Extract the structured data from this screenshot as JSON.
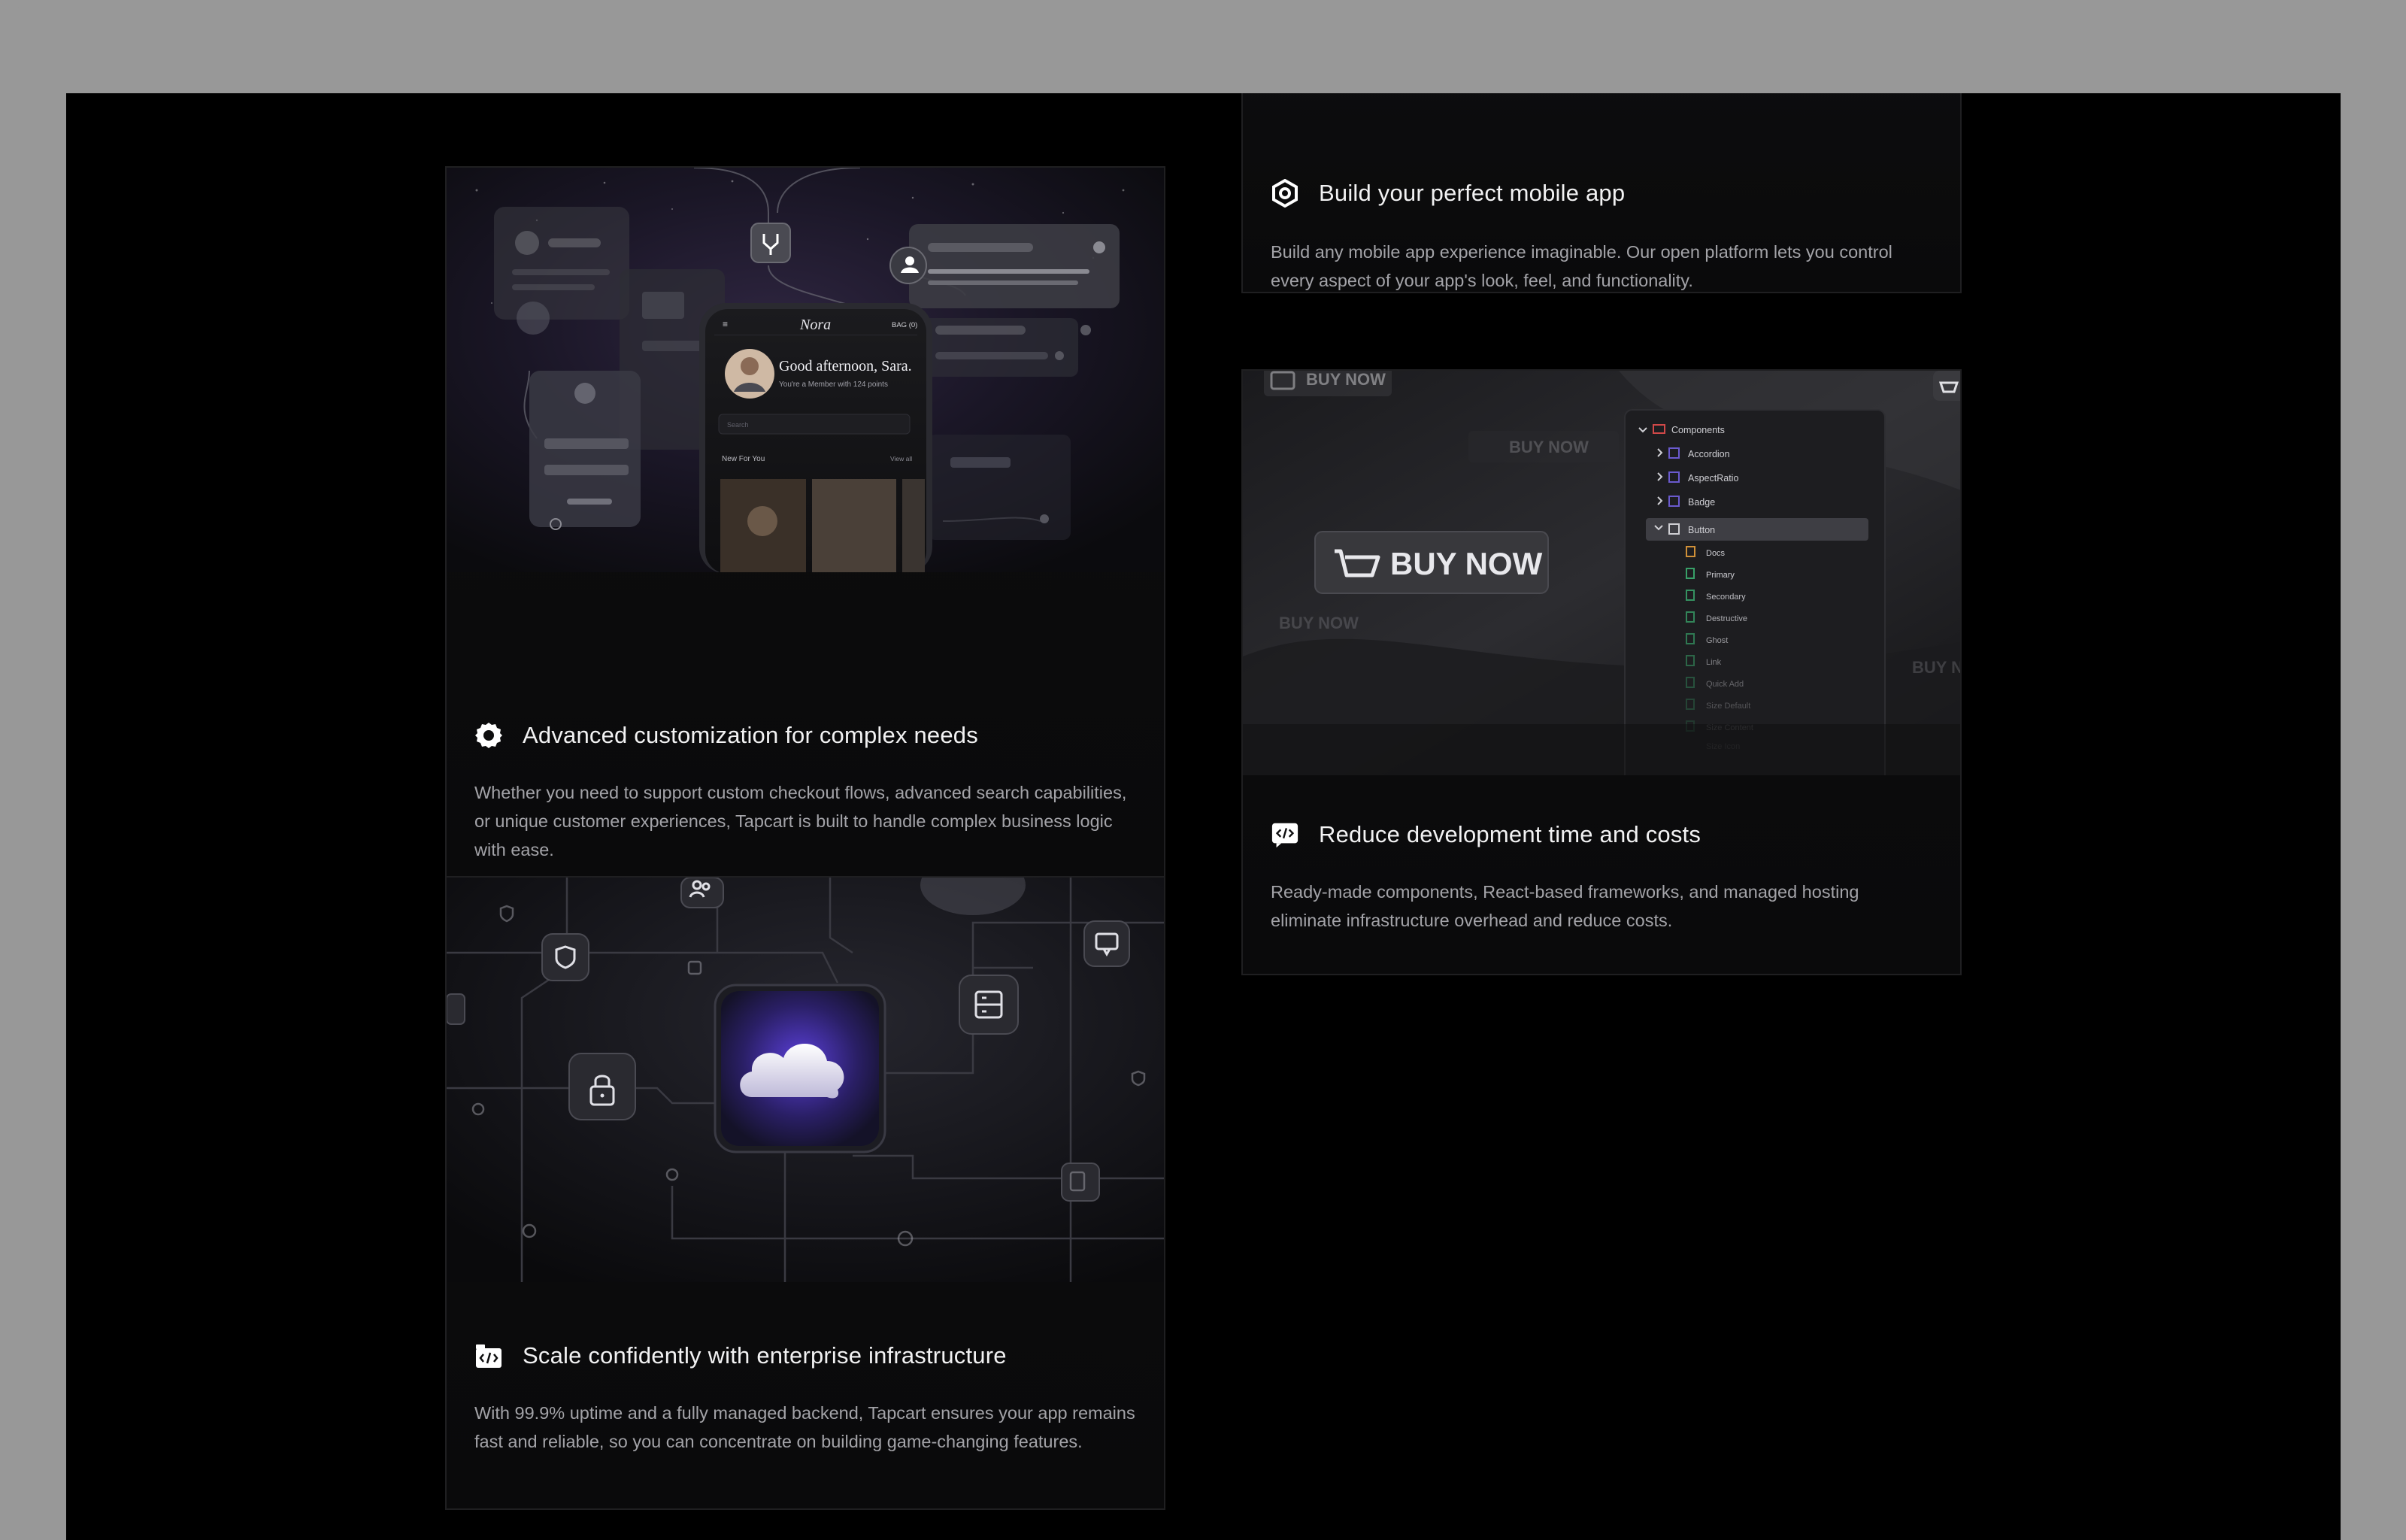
{
  "cards": [
    {
      "id": "customization",
      "icon": "gear-icon",
      "title": "Advanced customization for complex needs",
      "description": "Whether you need to support custom checkout flows, advanced search capabilities, or unique customer experiences, Tapcart is built to handle complex business logic with ease.",
      "mockup": {
        "brand": "Nora",
        "bag": "BAG (0)",
        "greeting": "Good afternoon, Sara.",
        "subtext": "You're a Member with 124 points",
        "search_placeholder": "Search",
        "section_label": "New For You",
        "section_link": "View all"
      }
    },
    {
      "id": "mobile-app",
      "icon": "hexagon-icon",
      "title": "Build your perfect mobile app",
      "description": "Build any mobile app experience imaginable. Our open platform lets you control every aspect of your app's look, feel, and functionality."
    },
    {
      "id": "dev-time",
      "icon": "code-icon",
      "title": "Reduce development time and costs",
      "description": "Ready-made components, React-based frameworks, and managed hosting eliminate infrastructure overhead and reduce costs.",
      "mockup": {
        "buy_now": "BUY NOW",
        "tree_root": "Components",
        "tree_items": [
          "Accordion",
          "AspectRatio",
          "Badge",
          "Button"
        ],
        "tree_children": [
          "Docs",
          "Primary",
          "Secondary",
          "Destructive",
          "Ghost",
          "Link",
          "Quick Add",
          "Size Default",
          "Size Content",
          "Size Icon"
        ]
      }
    },
    {
      "id": "infrastructure",
      "icon": "code-window-icon",
      "title": "Scale confidently with enterprise infrastructure",
      "description": "With 99.9% uptime and a fully managed backend, Tapcart ensures your app remains fast and reliable, so you can concentrate on building game-changing features."
    }
  ]
}
